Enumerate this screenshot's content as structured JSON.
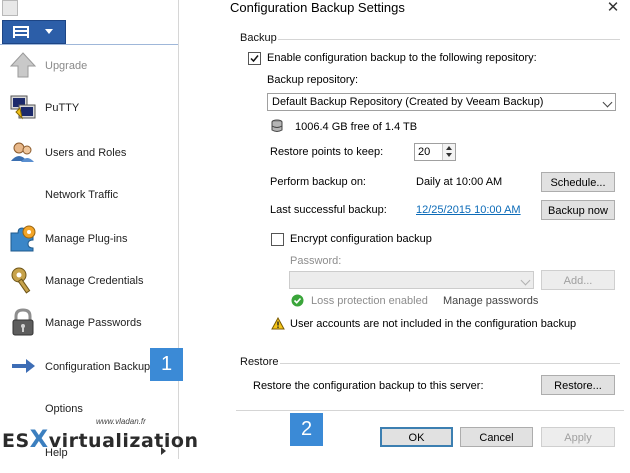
{
  "left_menu": {
    "items": [
      {
        "label": "Upgrade",
        "icon": "upgrade-arrow-icon",
        "disabled": true
      },
      {
        "label": "PuTTY",
        "icon": "putty-terminal-icon"
      },
      {
        "label": "Users and Roles",
        "icon": "users-icon"
      },
      {
        "label": "Network Traffic",
        "icon": ""
      },
      {
        "label": "Manage Plug-ins",
        "icon": "puzzle-plugin-icon"
      },
      {
        "label": "Manage Credentials",
        "icon": "key-credentials-icon"
      },
      {
        "label": "Manage Passwords",
        "icon": "padlock-passwords-icon"
      },
      {
        "label": "Configuration Backup",
        "icon": "arrow-right-icon"
      },
      {
        "label": "Options",
        "icon": ""
      },
      {
        "label": "Help",
        "icon": ""
      }
    ]
  },
  "annotations": {
    "badge1": "1",
    "badge2": "2"
  },
  "dialog": {
    "title": "Configuration Backup Settings",
    "close": "✕",
    "backup": {
      "section_title": "Backup",
      "enable_label": "Enable configuration backup to the following repository:",
      "enable_checked": true,
      "repo_label": "Backup repository:",
      "repo_value": "Default Backup Repository (Created by Veeam Backup)",
      "free_space": "1006.4 GB free of 1.4 TB",
      "restore_points_label": "Restore points to keep:",
      "restore_points_value": "20",
      "perform_label": "Perform backup on:",
      "perform_value": "Daily at 10:00 AM",
      "schedule_button": "Schedule...",
      "last_label": "Last successful backup:",
      "last_value": "12/25/2015 10:00 AM",
      "backup_now_button": "Backup now",
      "encrypt_label": "Encrypt configuration backup",
      "encrypt_checked": false,
      "password_label": "Password:",
      "password_value": "",
      "add_button": "Add...",
      "loss_protection": "Loss protection enabled",
      "manage_passwords": "Manage passwords",
      "warning": "User accounts are not included in the configuration backup"
    },
    "restore": {
      "section_title": "Restore",
      "description": "Restore the configuration backup to this server:",
      "restore_button": "Restore..."
    },
    "footer": {
      "ok": "OK",
      "cancel": "Cancel",
      "apply": "Apply"
    }
  },
  "watermark": {
    "small": "www.vladan.fr",
    "big_left": "ES",
    "big_x": "X",
    "big_right": "virtualization"
  },
  "colors": {
    "accent": "#2c5ea8",
    "badge": "#3b8ad6",
    "link": "#0c6bb8"
  }
}
